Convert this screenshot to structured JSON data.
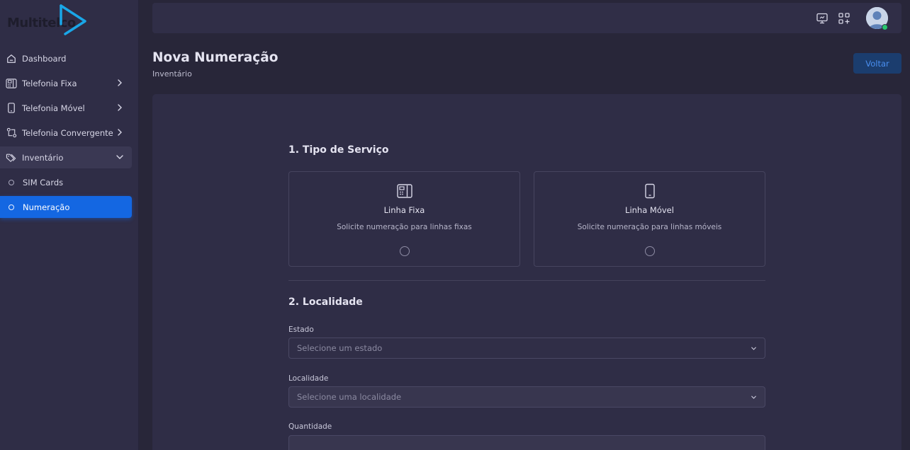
{
  "brand": {
    "name": "Multitelco"
  },
  "sidebar": {
    "items": [
      {
        "label": "Dashboard"
      },
      {
        "label": "Telefonia Fixa"
      },
      {
        "label": "Telefonia Móvel"
      },
      {
        "label": "Telefonia Convergente"
      },
      {
        "label": "Inventário"
      },
      {
        "label": "SIM Cards"
      },
      {
        "label": "Numeração"
      }
    ]
  },
  "header": {
    "title": "Nova Numeração",
    "breadcrumb": "Inventário",
    "back_label": "Voltar"
  },
  "form": {
    "section1_title": "1. Tipo de Serviço",
    "options": [
      {
        "title": "Linha Fixa",
        "description": "Solicite numeração para linhas fixas"
      },
      {
        "title": "Linha Móvel",
        "description": "Solicite numeração para linhas móveis"
      }
    ],
    "section2_title": "2. Localidade",
    "estado_label": "Estado",
    "estado_placeholder": "Selecione um estado",
    "localidade_label": "Localidade",
    "localidade_placeholder": "Selecione uma localidade",
    "quantidade_label": "Quantidade",
    "quantidade_value": ""
  },
  "colors": {
    "accent": "#1467e2",
    "background": "#282639",
    "surface": "#2f2d46",
    "status_online": "#28c76f"
  },
  "icons": {
    "dashboard": "home-icon",
    "fixa": "desk-phone-icon",
    "movel": "smartphone-icon",
    "convergente": "convergence-icon",
    "inventario": "tag-icon"
  }
}
